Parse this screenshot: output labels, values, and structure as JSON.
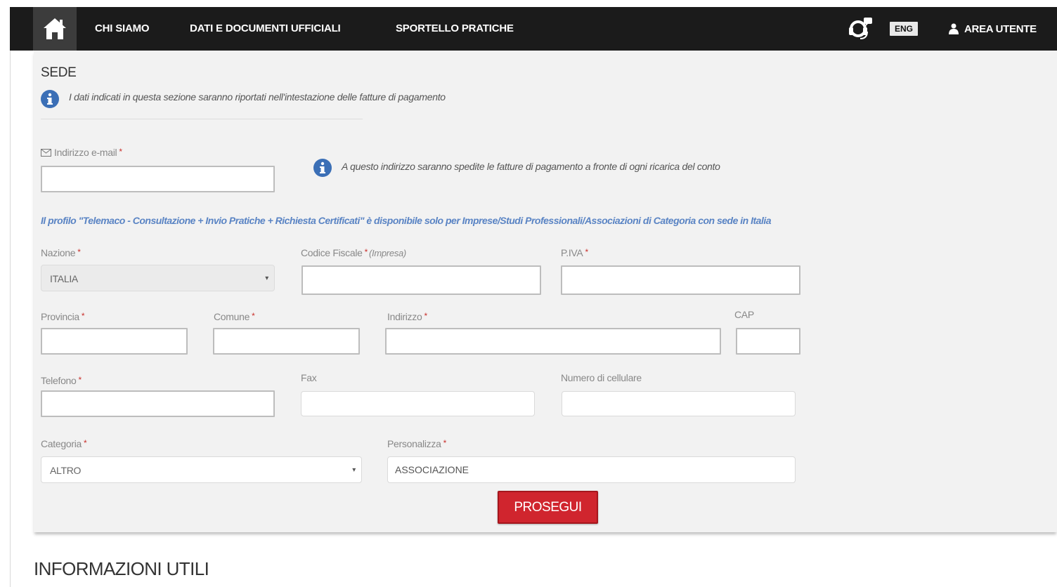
{
  "nav": {
    "links": [
      "CHI SIAMO",
      "DATI E DOCUMENTI UFFICIALI",
      "SPORTELLO PRATICHE"
    ],
    "lang": "ENG",
    "user_area": "AREA UTENTE"
  },
  "section": {
    "title": "SEDE",
    "info": "I dati indicati in questa sezione saranno riportati nell'intestazione delle fatture di pagamento"
  },
  "email": {
    "label": "Indirizzo e-mail",
    "value": "",
    "info": "A questo indirizzo saranno spedite le fatture di pagamento a fronte di ogni ricarica del conto"
  },
  "notice": "Il profilo \"Telemaco - Consultazione + Invio Pratiche + Richiesta Certificati\" è disponibile solo per Imprese/Studi Professionali/Associazioni di Categoria con sede in Italia",
  "fields": {
    "nazione": {
      "label": "Nazione",
      "value": "ITALIA"
    },
    "codice_fiscale": {
      "label": "Codice Fiscale",
      "note": "(Impresa)",
      "value": ""
    },
    "piva": {
      "label": "P.IVA",
      "value": ""
    },
    "provincia": {
      "label": "Provincia",
      "value": ""
    },
    "comune": {
      "label": "Comune",
      "value": ""
    },
    "indirizzo": {
      "label": "Indirizzo",
      "value": ""
    },
    "cap": {
      "label": "CAP",
      "value": ""
    },
    "telefono": {
      "label": "Telefono",
      "value": ""
    },
    "fax": {
      "label": "Fax",
      "value": ""
    },
    "cellulare": {
      "label": "Numero di cellulare",
      "value": ""
    },
    "categoria": {
      "label": "Categoria",
      "value": "ALTRO"
    },
    "personalizza": {
      "label": "Personalizza",
      "value": "ASSOCIAZIONE"
    }
  },
  "actions": {
    "submit": "PROSEGUI"
  },
  "footer": {
    "heading": "INFORMAZIONI UTILI"
  },
  "colors": {
    "navbar": "#1b1b1b",
    "accent_red": "#d0252e",
    "info_blue": "#3b6fb6",
    "required": "#c9302c"
  }
}
